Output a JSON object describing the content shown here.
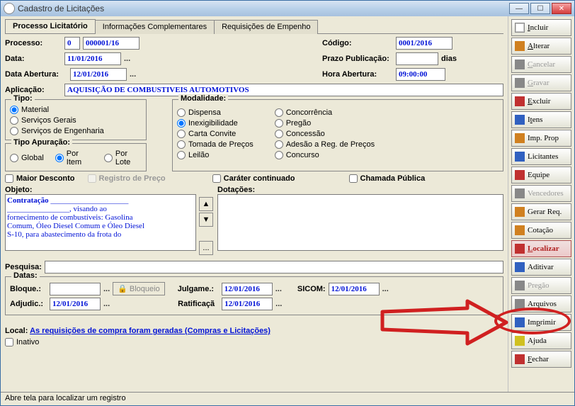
{
  "window": {
    "title": "Cadastro de Licitações"
  },
  "tabs": {
    "processo": "Processo Licitatório",
    "info": "Informações Complementares",
    "req": "Requisições  de Empenho"
  },
  "labels": {
    "processo": "Processo:",
    "codigo": "Código:",
    "data": "Data:",
    "prazo": "Prazo Publicação:",
    "dias": "dias",
    "data_abertura": "Data Abertura:",
    "hora_abertura": "Hora Abertura:",
    "aplicacao": "Aplicação:",
    "tipo": "Tipo:",
    "modalidade": "Modalidade:",
    "tipo_apuracao": "Tipo Apuração:",
    "maior_desconto": "Maior Desconto",
    "registro_preco": "Registro de Preço",
    "carater": "Caráter continuado",
    "chamada": "Chamada Pública",
    "objeto": "Objeto:",
    "dotacoes": "Dotações:",
    "pesquisa": "Pesquisa:",
    "datas": "Datas:",
    "bloque": "Bloque.:",
    "bloqueio": "Bloqueio",
    "julgame": "Julgame.:",
    "sicom": "SICOM:",
    "adjudic": "Adjudic.:",
    "ratifica": "Ratificaçã",
    "local": "Local:",
    "inativo": "Inativo"
  },
  "fields": {
    "processo_zero": "0",
    "processo_num": "000001/16",
    "codigo": "0001/2016",
    "data": "11/01/2016",
    "prazo": "",
    "data_abertura": "12/01/2016",
    "hora_abertura": "09:00:00",
    "aplicacao": "AQUISIÇÃO DE COMBUSTIVEIS AUTOMOTIVOS",
    "pesquisa": "",
    "bloque": "",
    "julgame": "12/01/2016",
    "sicom": "12/01/2016",
    "adjudic": "12/01/2016",
    "ratifica": "12/01/2016"
  },
  "tipo": {
    "material": "Material",
    "servicos": "Serviços Gerais",
    "eng": "Serviços de Engenharia"
  },
  "modalidade": {
    "dispensa": "Dispensa",
    "inexig": "Inexigibilidade",
    "carta": "Carta Convite",
    "tomada": "Tomada de Preços",
    "leilao": "Leilão",
    "concor": "Concorrência",
    "pregao": "Pregão",
    "concessao": "Concessão",
    "adesao": "Adesão a Reg. de Preços",
    "concurso": "Concurso"
  },
  "apuracao": {
    "global": "Global",
    "poritem": "Por Item",
    "porlote": "Por Lote"
  },
  "objeto_text": "Contratação ____________________ ______________, visando ao fornecimento de combustíveis: Gasolina Comum, Óleo Diesel Comum e Óleo Diesel S-10, para abastecimento da frota do",
  "local_text": "As requisições de compra foram geradas (Compras e Licitações)",
  "side": {
    "incluir": "Incluir",
    "alterar": "Alterar",
    "cancelar": "Cancelar",
    "gravar": "Gravar",
    "excluir": "Excluir",
    "itens": "Itens",
    "impprop": "Imp. Prop",
    "licitantes": "Licitantes",
    "equipe": "Equipe",
    "vencedores": "Vencedores",
    "gerarreq": "Gerar Req.",
    "cotacao": "Cotação",
    "localizar": "Localizar",
    "aditivar": "Aditivar",
    "pregao": "Pregão",
    "arquivos": "Arquivos",
    "imprimir": "Imprimir",
    "ajuda": "Ajuda",
    "fechar": "Fechar"
  },
  "status": "Abre tela para localizar um registro"
}
